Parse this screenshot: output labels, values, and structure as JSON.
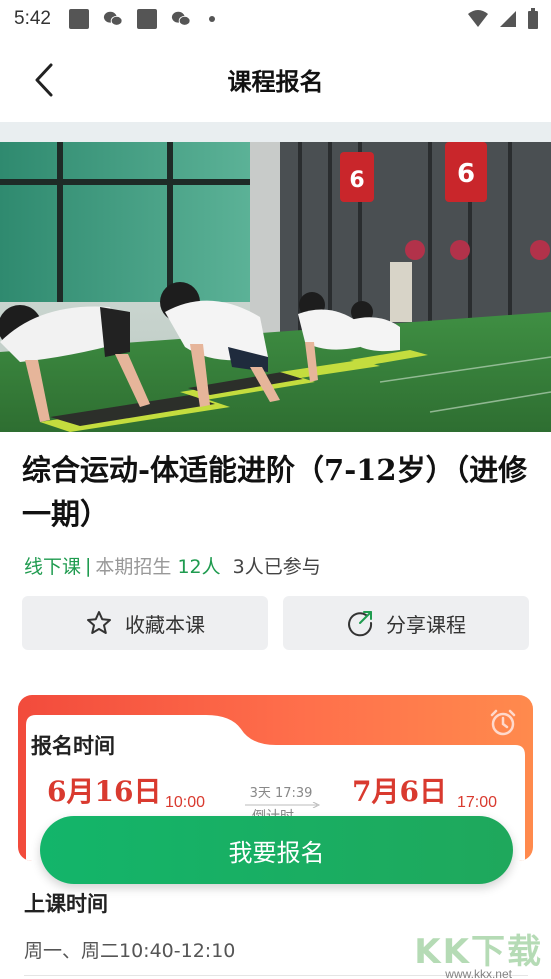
{
  "status_bar": {
    "time": "5:42",
    "icons": [
      "square-icon",
      "wechat-icon",
      "square-icon",
      "wechat-icon",
      "dot-icon"
    ],
    "right_icons": [
      "wifi-icon",
      "signal-icon",
      "battery-icon"
    ]
  },
  "header": {
    "title": "课程报名",
    "back_icon": "chevron-left-icon"
  },
  "hero": {
    "signs": [
      "6",
      "6"
    ]
  },
  "course": {
    "title": "综合运动-体适能进阶（7-12岁）（进修一期）",
    "mode": "线下课",
    "separator": "|",
    "enroll_label": "本期招生",
    "enroll_count": "12人",
    "joined": "3人已参与"
  },
  "actions": {
    "favorite_label": "收藏本课",
    "favorite_icon": "star-icon",
    "share_label": "分享课程",
    "share_icon": "share-icon"
  },
  "registration": {
    "title": "报名时间",
    "alarm_icon": "alarm-clock-icon",
    "start_date": "6月16日",
    "start_time": "10:00",
    "countdown": "3天 17:39",
    "countdown_label": "倒计时",
    "end_date": "7月6日",
    "end_time": "17:00"
  },
  "enroll_button": "我要报名",
  "class_time": {
    "title": "上课时间",
    "value": "周一、周二10:40-12:10"
  },
  "watermark": {
    "main": "KK下载",
    "sub": "www.kkx.net"
  },
  "colors": {
    "accent_green": "#1f9b4f",
    "card_red": "#f24b3c",
    "date_red": "#d93a2f"
  }
}
